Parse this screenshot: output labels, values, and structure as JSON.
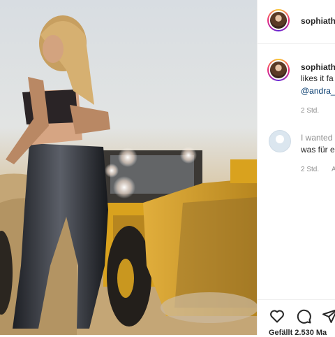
{
  "post": {
    "username": "sophiath",
    "caption_username": "sophiath",
    "caption_text": "likes it fa",
    "caption_mention": "@andra_",
    "caption_time": "2 Std.",
    "comment_text_line1": "I wanted",
    "comment_text_line2": "was für e",
    "comment_time": "2 Std.",
    "comment_reply": "A",
    "likes_text": "Gefällt 2.530 Ma"
  },
  "icons": {
    "like": "heart-icon",
    "comment": "comment-bubble-icon",
    "share": "paper-plane-icon"
  },
  "colors": {
    "text": "#262626",
    "muted": "#8e8e8e",
    "link": "#00376b",
    "machine_yellow": "#d9a21e"
  }
}
